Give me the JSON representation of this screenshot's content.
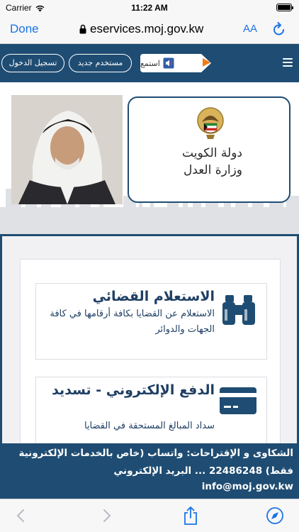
{
  "status_bar": {
    "carrier": "Carrier",
    "time": "11:22 AM",
    "battery_level": 1.0
  },
  "browser": {
    "done_label": "Done",
    "url": "eservices.moj.gov.kw",
    "text_size_label": "AA"
  },
  "header": {
    "login_label": "تسجيل الدخول",
    "new_user_label": "مستخدم جديد",
    "listen_label": "استمع"
  },
  "banner": {
    "country": "دولة الكويت",
    "ministry": "وزارة العدل"
  },
  "services": [
    {
      "title": "الاستعلام القضائي",
      "description": "الاستعلام عن القضايا بكافة أرقامها في كافة الجهات والدوائر",
      "icon": "binoculars-icon"
    },
    {
      "title": "الدفع الإلكتروني - تسديد",
      "description": "سداد المبالغ المستحقة في القضايا",
      "icon": "credit-card-icon"
    }
  ],
  "footer": {
    "complaints_text": "الشكاوى و الإقتراحات: واتساب (خاص بالخدمات الإلكترونية فقط) 22486248 ... البريد الإلكتروني",
    "email": "info@moj.gov.kw"
  },
  "colors": {
    "primary": "#1f4c72",
    "accent": "#ef7d12",
    "ios_blue": "#1a73e8"
  }
}
